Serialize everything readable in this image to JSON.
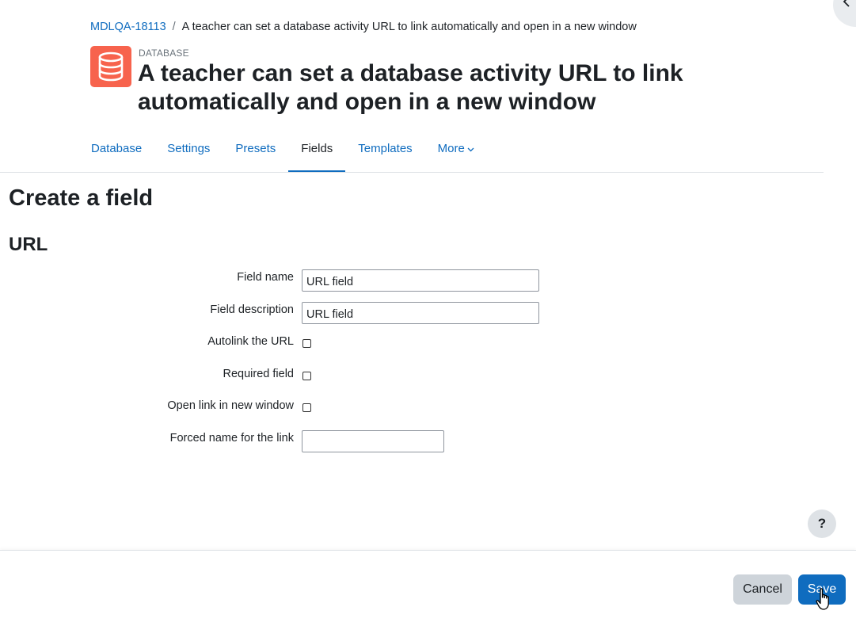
{
  "breadcrumb": {
    "course": "MDLQA-18113",
    "current": "A teacher can set a database activity URL to link automatically and open in a new window"
  },
  "header": {
    "activity_type": "DATABASE",
    "title": "A teacher can set a database activity URL to link automatically and open in a new window",
    "icon": "database-icon",
    "icon_color": "#f7634d"
  },
  "tabs": [
    {
      "label": "Database",
      "active": false
    },
    {
      "label": "Settings",
      "active": false
    },
    {
      "label": "Presets",
      "active": false
    },
    {
      "label": "Fields",
      "active": true
    },
    {
      "label": "Templates",
      "active": false
    },
    {
      "label": "More",
      "active": false
    }
  ],
  "main": {
    "heading": "Create a field",
    "field_type": "URL"
  },
  "form": {
    "field_name": {
      "label": "Field name",
      "value": "URL field"
    },
    "field_description": {
      "label": "Field description",
      "value": "URL field"
    },
    "autolink": {
      "label": "Autolink the URL",
      "checked": false
    },
    "required": {
      "label": "Required field",
      "checked": false
    },
    "new_window": {
      "label": "Open link in new window",
      "checked": false
    },
    "forced_name": {
      "label": "Forced name for the link",
      "value": ""
    }
  },
  "help": {
    "label": "?"
  },
  "footer": {
    "cancel_label": "Cancel",
    "save_label": "Save"
  },
  "colors": {
    "link": "#0f6cbf",
    "primary_button": "#0f6cbf",
    "secondary_button": "#ced4da"
  }
}
